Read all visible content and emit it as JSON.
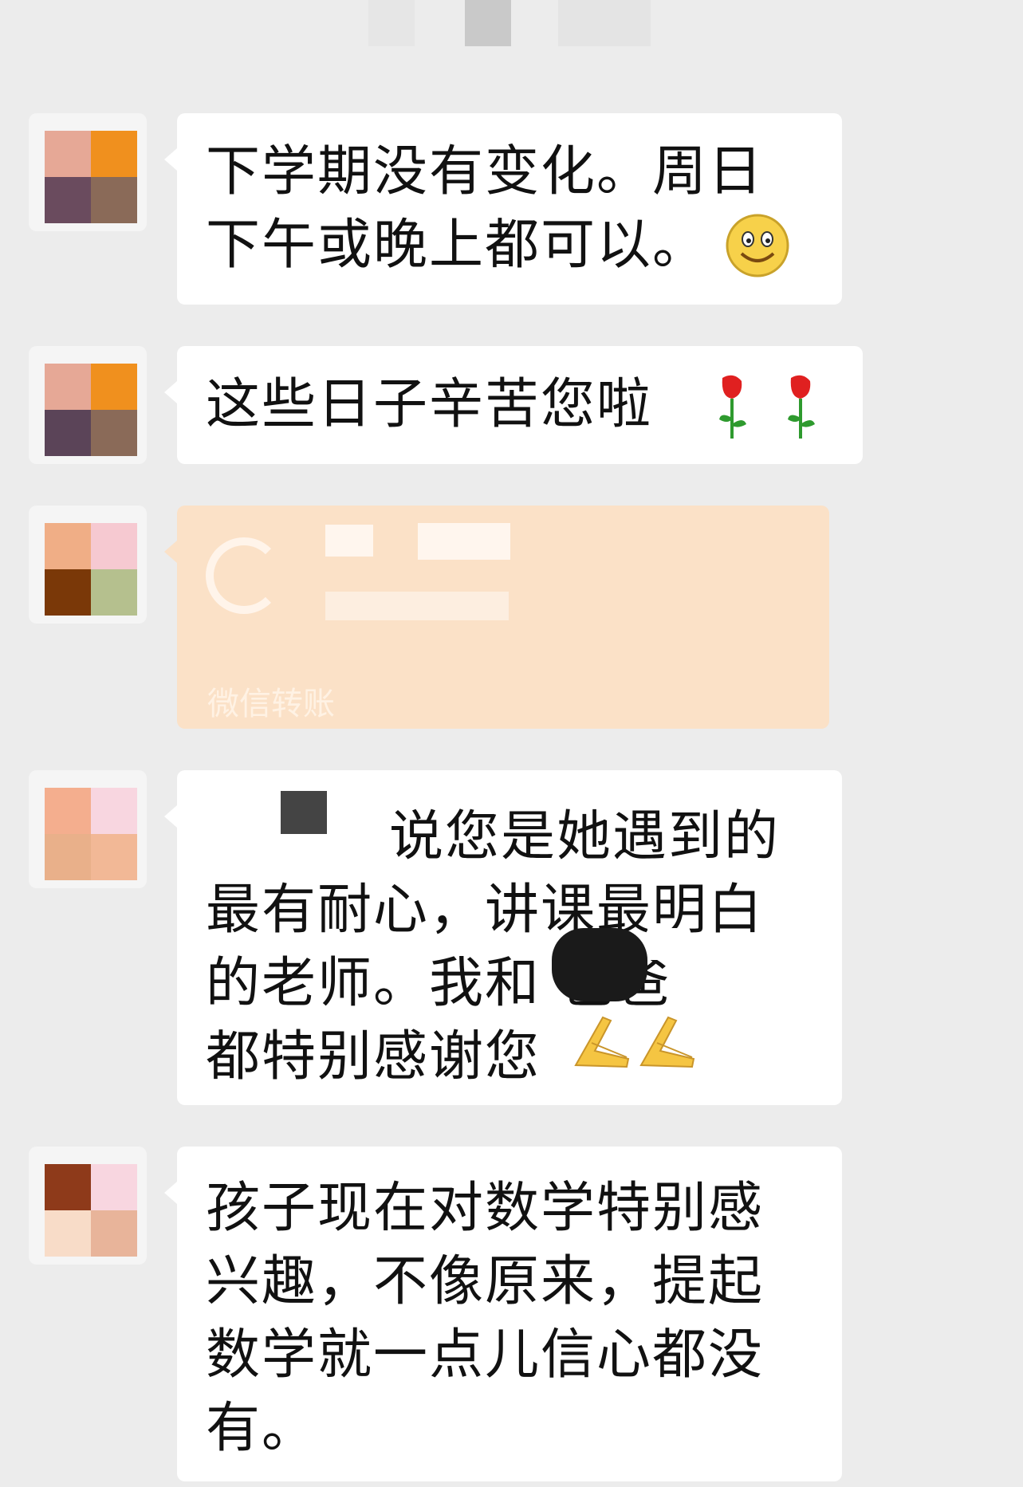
{
  "messages": [
    {
      "text": "下学期没有变化。周日\n下午或晚上都可以。",
      "emoji": "smile-emoji"
    },
    {
      "text": "这些日子辛苦您啦",
      "emoji": "rose-emoji"
    },
    {
      "transfer_label": "微信转账"
    },
    {
      "text": "说您是她遇到的\n最有耐心，讲课最明白\n的老师。我和 爸爸\n都特别感谢您",
      "emoji": "pray-emoji"
    },
    {
      "text": "孩子现在对数学特别感\n兴趣，不像原来，提起\n数学就一点儿信心都没\n有。"
    }
  ],
  "colors": {
    "background": "#ececec",
    "bubble": "#ffffff",
    "transfer": "#fbe1c7"
  }
}
